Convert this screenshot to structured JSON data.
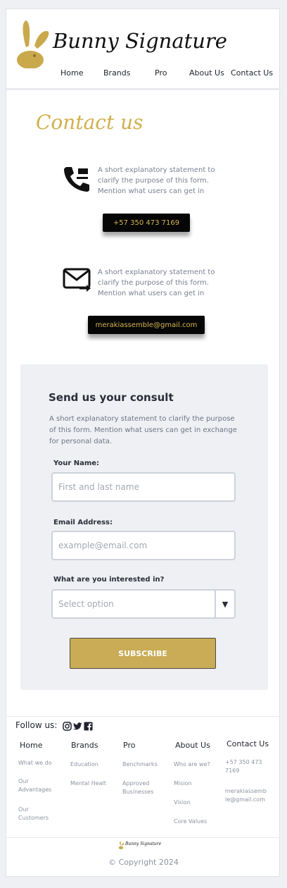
{
  "header": {
    "brand": "Bunny Signature",
    "nav": [
      "Home",
      "Brands",
      "Pro",
      "About Us",
      "Contact Us"
    ]
  },
  "main": {
    "title": "Contact us",
    "phone": {
      "icon": "phone-forward-icon",
      "text": "A short explanatory statement to clarify the purpose of this form. Mention what users can get in",
      "button": "+57 350 473 7169"
    },
    "email": {
      "icon": "mail-forward-icon",
      "text": "A short explanatory statement to clarify the purpose of this form. Mention what users can get in",
      "button": "merakiassemble@gmail.com"
    }
  },
  "form": {
    "title": "Send us your consult",
    "description": "A short explanatory statement to clarify the purpose of this form. Mention what users can get in exchange for personal data.",
    "name_label": "Your Name:",
    "name_placeholder": "First and last name",
    "email_label": "Email Address:",
    "email_placeholder": "example@email.com",
    "interest_label": "What are you interested in?",
    "interest_value": "Select option",
    "submit": "SUBSCRIBE"
  },
  "footer": {
    "follow_label": "Follow us:",
    "social_icons": [
      "instagram-icon",
      "twitter-icon",
      "facebook-icon"
    ],
    "columns": [
      {
        "title": "Home",
        "items": [
          "What we do",
          "Our Advantages",
          "Our Customers"
        ]
      },
      {
        "title": "Brands",
        "items": [
          "Education",
          "Mental Healt"
        ]
      },
      {
        "title": "Pro",
        "items": [
          "Benchmarks",
          "Approved Businesses"
        ]
      },
      {
        "title": "About Us",
        "items": [
          "Who are we?",
          "Mision",
          "Vision",
          "Core Values"
        ]
      },
      {
        "title": "Contact Us",
        "items": [
          "+57 350 473 7169",
          "merakiassemble@gmail.com"
        ]
      }
    ],
    "small_brand": "Bunny Signature",
    "copyright": "© Copyright 2024"
  },
  "colors": {
    "accent": "#c9ac55",
    "dark": "#060606",
    "panel": "#eef0f3"
  }
}
